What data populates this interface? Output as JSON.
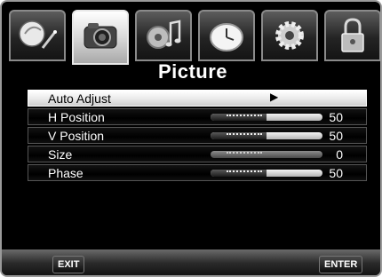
{
  "tabs": [
    {
      "icon": "satellite-dish-icon",
      "active": false
    },
    {
      "icon": "camera-icon",
      "active": true
    },
    {
      "icon": "music-note-icon",
      "active": false
    },
    {
      "icon": "clock-icon",
      "active": false
    },
    {
      "icon": "gear-icon",
      "active": false
    },
    {
      "icon": "lock-icon",
      "active": false
    }
  ],
  "title": "Picture",
  "menu": {
    "items": [
      {
        "label": "Auto Adjust",
        "arrow": "▶"
      },
      {
        "label": "H Position",
        "value": "50"
      },
      {
        "label": "V Position",
        "value": "50"
      },
      {
        "label": "Size",
        "value": "0"
      },
      {
        "label": "Phase",
        "value": "50"
      }
    ],
    "levels": [
      50,
      50,
      0,
      50
    ],
    "selected_index": 0
  },
  "footer": {
    "exit_label": "EXIT",
    "enter_label": "ENTER"
  }
}
